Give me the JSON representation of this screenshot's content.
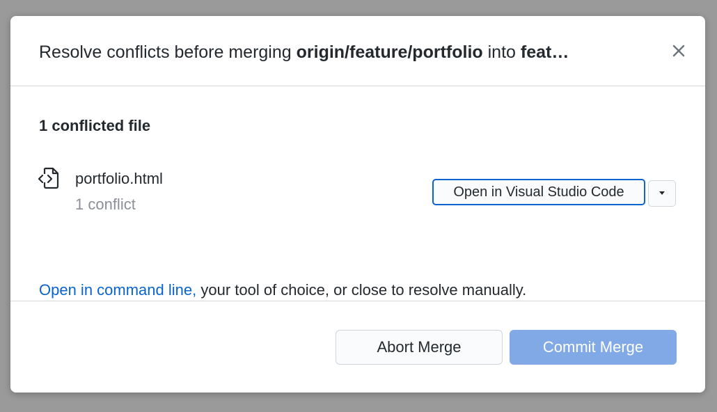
{
  "dialog": {
    "title_prefix": "Resolve conflicts before merging ",
    "source_branch": "origin/feature/portfolio",
    "title_middle": " into ",
    "target_branch": "feat…"
  },
  "body": {
    "section_title": "1 conflicted file",
    "file": {
      "icon": "file-code-icon",
      "name": "portfolio.html",
      "status": "1 conflict"
    },
    "open_button_label": "Open in Visual Studio Code",
    "dropdown_icon": "caret-down-icon",
    "help_link": "Open in command line,",
    "help_text": " your tool of choice, or close to resolve manually."
  },
  "footer": {
    "abort_label": "Abort Merge",
    "commit_label": "Commit Merge"
  },
  "colors": {
    "accent": "#0a63cf",
    "commit_disabled": "#80a9e6",
    "overlay": "#9a9a9a"
  }
}
